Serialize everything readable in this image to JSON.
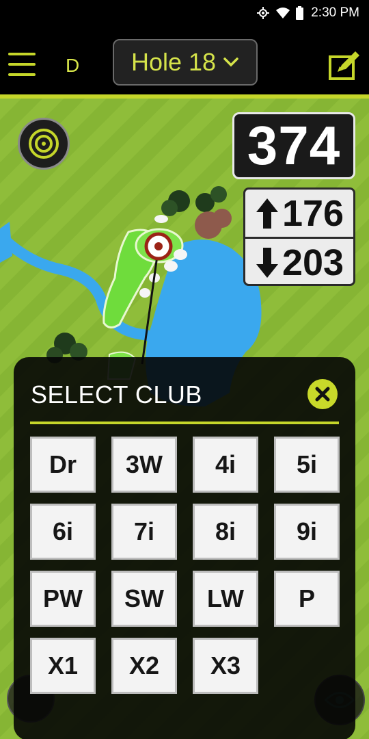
{
  "status": {
    "time": "2:30 PM"
  },
  "header": {
    "tee": "D",
    "hole_label": "Hole 18"
  },
  "distances": {
    "main": "374",
    "front": "176",
    "back": "203"
  },
  "club_panel": {
    "title": "SELECT CLUB",
    "clubs": [
      "Dr",
      "3W",
      "4i",
      "5i",
      "6i",
      "7i",
      "8i",
      "9i",
      "PW",
      "SW",
      "LW",
      "P",
      "X1",
      "X2",
      "X3"
    ]
  },
  "colors": {
    "accent": "#c5d62a",
    "fairway": "#86b534",
    "water": "#3aa8ee",
    "green": "#7ee24a",
    "pin": "#9b2316"
  },
  "icons": {
    "menu": "menu-icon",
    "chevron": "chevron-down-icon",
    "edit": "edit-icon",
    "target": "target-icon",
    "close": "close-icon",
    "eye": "eye-icon"
  }
}
